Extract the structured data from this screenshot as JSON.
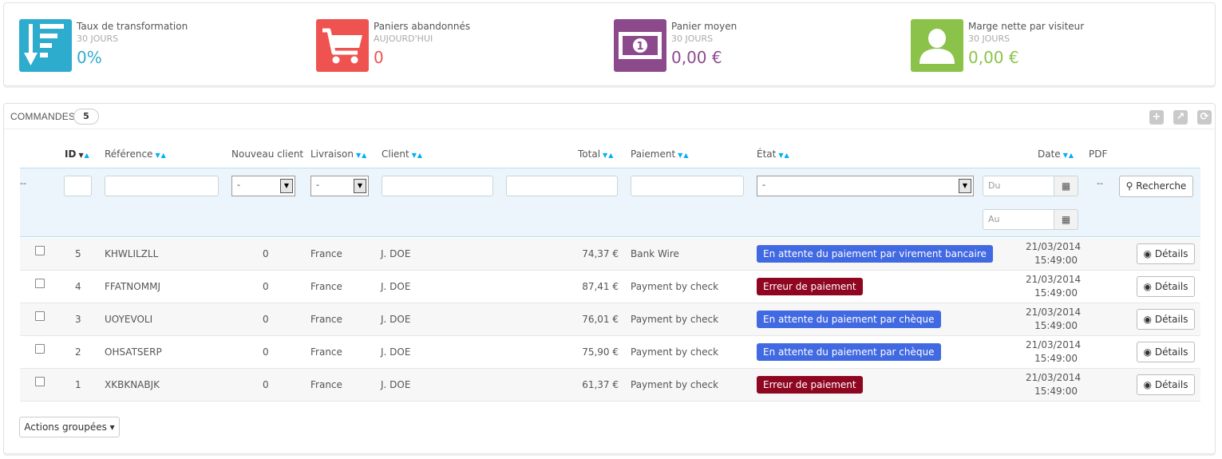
{
  "kpis": [
    {
      "title": "Taux de transformation",
      "sub": "30 JOURS",
      "value": "0%",
      "color": "#2eacce",
      "icon": "transformation-icon"
    },
    {
      "title": "Paniers abandonnés",
      "sub": "AUJOURD'HUI",
      "value": "0",
      "color": "#ef5350",
      "icon": "cart-icon"
    },
    {
      "title": "Panier moyen",
      "sub": "30 JOURS",
      "value": "0,00 €",
      "color": "#8c4a8c",
      "icon": "money-icon"
    },
    {
      "title": "Marge nette par visiteur",
      "sub": "30 JOURS",
      "value": "0,00 €",
      "color": "#8bc34a",
      "icon": "user-icon"
    }
  ],
  "orders": {
    "title": "COMMANDES",
    "count": "5",
    "columns": {
      "id": "ID",
      "reference": "Référence",
      "new_client": "Nouveau client",
      "delivery": "Livraison",
      "client": "Client",
      "total": "Total",
      "payment": "Paiement",
      "state": "État",
      "date": "Date",
      "pdf": "PDF"
    },
    "filters": {
      "select_dash": "-",
      "date_from_placeholder": "Du",
      "date_to_placeholder": "Au",
      "search_label": "Recherche"
    },
    "rows": [
      {
        "id": "5",
        "reference": "KHWLILZLL",
        "new_client": "0",
        "delivery": "France",
        "client": "J. DOE",
        "total": "74,37 €",
        "payment": "Bank Wire",
        "state": "En attente du paiement par virement bancaire",
        "state_color": "#4169e1",
        "date": "21/03/2014",
        "time": "15:49:00"
      },
      {
        "id": "4",
        "reference": "FFATNOMMJ",
        "new_client": "0",
        "delivery": "France",
        "client": "J. DOE",
        "total": "87,41 €",
        "payment": "Payment by check",
        "state": "Erreur de paiement",
        "state_color": "#8f0621",
        "date": "21/03/2014",
        "time": "15:49:00"
      },
      {
        "id": "3",
        "reference": "UOYEVOLI",
        "new_client": "0",
        "delivery": "France",
        "client": "J. DOE",
        "total": "76,01 €",
        "payment": "Payment by check",
        "state": "En attente du paiement par chèque",
        "state_color": "#4169e1",
        "date": "21/03/2014",
        "time": "15:49:00"
      },
      {
        "id": "2",
        "reference": "OHSATSERP",
        "new_client": "0",
        "delivery": "France",
        "client": "J. DOE",
        "total": "75,90 €",
        "payment": "Payment by check",
        "state": "En attente du paiement par chèque",
        "state_color": "#4169e1",
        "date": "21/03/2014",
        "time": "15:49:00"
      },
      {
        "id": "1",
        "reference": "XKBKNABJK",
        "new_client": "0",
        "delivery": "France",
        "client": "J. DOE",
        "total": "61,37 €",
        "payment": "Payment by check",
        "state": "Erreur de paiement",
        "state_color": "#8f0621",
        "date": "21/03/2014",
        "time": "15:49:00"
      }
    ],
    "details_label": "Détails",
    "bulk_actions_label": "Actions groupées"
  }
}
